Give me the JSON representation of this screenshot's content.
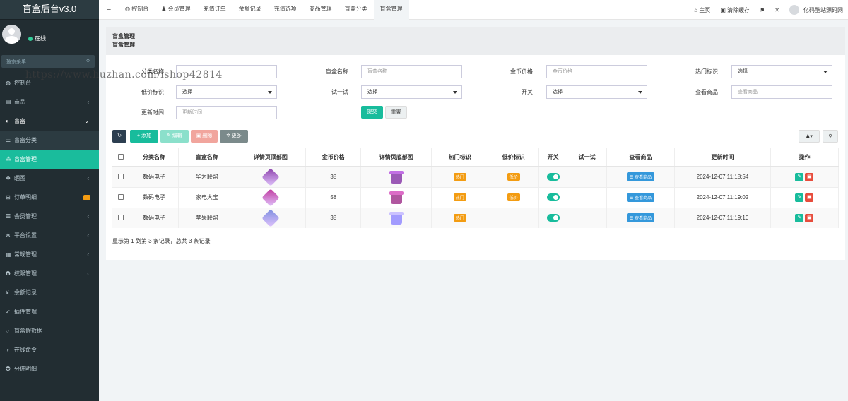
{
  "app": {
    "title": "盲盒后台v3.0",
    "status": "在线"
  },
  "sidebar": {
    "search_placeholder": "搜索菜单",
    "items": [
      {
        "label": "控制台",
        "icon": "dashboard-icon",
        "glyph": "◍"
      },
      {
        "label": "商品",
        "icon": "box-icon",
        "glyph": "▤",
        "chevron": "‹"
      },
      {
        "label": "盲盒",
        "icon": "cube-icon",
        "glyph": "◐",
        "chevron": "⌄"
      },
      {
        "label": "盲盒分类",
        "icon": "list-icon",
        "glyph": "☰"
      },
      {
        "label": "盲盒管理",
        "icon": "cubes-icon",
        "glyph": "⁂"
      },
      {
        "label": "晒图",
        "icon": "gift-icon",
        "glyph": "❖",
        "chevron": "‹"
      },
      {
        "label": "订单明细",
        "icon": "cart-icon",
        "glyph": "⊞"
      },
      {
        "label": "会员管理",
        "icon": "list-icon",
        "glyph": "☰",
        "chevron": "‹"
      },
      {
        "label": "平台设置",
        "icon": "gear-icon",
        "glyph": "✲",
        "chevron": "‹"
      },
      {
        "label": "常规管理",
        "icon": "database-icon",
        "glyph": "▦",
        "chevron": "‹"
      },
      {
        "label": "权限管理",
        "icon": "users-icon",
        "glyph": "✪",
        "chevron": "‹"
      },
      {
        "label": "余额记录",
        "icon": "yen-icon",
        "glyph": "¥"
      },
      {
        "label": "插件管理",
        "icon": "rocket-icon",
        "glyph": "➶"
      },
      {
        "label": "盲盒假数据",
        "icon": "circle-icon",
        "glyph": "○"
      },
      {
        "label": "在线命令",
        "icon": "terminal-icon",
        "glyph": "◑"
      },
      {
        "label": "分佣明细",
        "icon": "users-icon",
        "glyph": "✪"
      }
    ]
  },
  "topbar": {
    "tabs": [
      {
        "label": "控制台",
        "glyph": "◍ "
      },
      {
        "label": "会员管理",
        "glyph": "♟ "
      },
      {
        "label": "充值订单",
        "glyph": ""
      },
      {
        "label": "余额记录",
        "glyph": ""
      },
      {
        "label": "充值选项",
        "glyph": ""
      },
      {
        "label": "商品管理",
        "glyph": ""
      },
      {
        "label": "盲盒分类",
        "glyph": ""
      },
      {
        "label": "盲盒管理",
        "glyph": ""
      }
    ],
    "home": "主页",
    "clear_cache": "清除缓存",
    "username": "亿码酷站源码网"
  },
  "breadcrumb": {
    "title": "盲盒管理",
    "sub": "盲盒管理"
  },
  "filters": {
    "category_label": "分类名称",
    "box_name_label": "盲盒名称",
    "box_name_placeholder": "盲盒名称",
    "price_label": "金币价格",
    "price_placeholder": "金币价格",
    "hot_label": "热门标识",
    "hot_value": "选择",
    "low_label": "低价标识",
    "low_value": "选择",
    "try_label": "试一试",
    "try_value": "选择",
    "switch_label": "开关",
    "switch_value": "选择",
    "view_label": "查看商品",
    "view_placeholder": "查看商品",
    "updated_label": "更新时间",
    "updated_placeholder": "更新时间",
    "submit": "提交",
    "reset": "重置"
  },
  "toolbar": {
    "add": "添加",
    "edit": "编辑",
    "delete": "删除",
    "more": "更多"
  },
  "table": {
    "headers": [
      "分类名称",
      "盲盒名称",
      "详情页顶部图",
      "金币价格",
      "详情页底部图",
      "热门标识",
      "低价标识",
      "开关",
      "试一试",
      "查看商品",
      "更新时间",
      "操作"
    ],
    "rows": [
      {
        "category": "数码电子",
        "name": "华为联盟",
        "price": "38",
        "hot": "热门",
        "low": "低价",
        "view": "查看商品",
        "updated": "2024-12-07 11:18:54",
        "top_color": "#8e44ad",
        "bottom_color": "#9b59b6"
      },
      {
        "category": "数码电子",
        "name": "家电大宝",
        "price": "58",
        "hot": "热门",
        "low": "低价",
        "view": "查看商品",
        "updated": "2024-12-07 11:19:02",
        "top_color": "#c0399f",
        "bottom_color": "#b0569f"
      },
      {
        "category": "数码电子",
        "name": "苹果联盟",
        "price": "38",
        "hot": "热门",
        "low": "",
        "view": "查看商品",
        "updated": "2024-12-07 11:19:10",
        "top_color": "#7f8fe0",
        "bottom_color": "#a29bfe"
      }
    ]
  },
  "footer_text": "显示第 1 到第 3 条记录，总共 3 条记录",
  "watermark": "https://www.huzhan.com/ishop42814",
  "colors": {
    "accent": "#18bc9c",
    "sidebar": "#222d32",
    "warning": "#f39c12",
    "danger": "#e74c3c",
    "info": "#3498db"
  }
}
